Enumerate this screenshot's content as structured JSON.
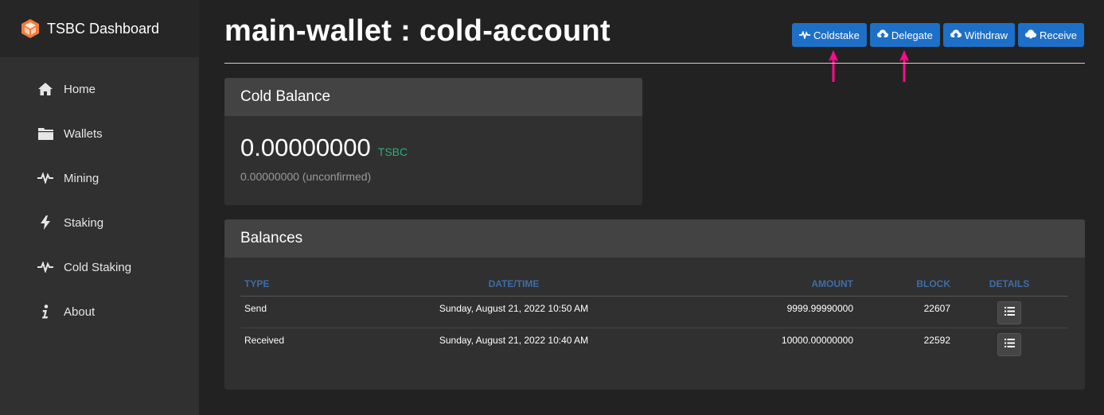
{
  "brand": {
    "name": "TSBC Dashboard",
    "logo_color": "#ef7d3a"
  },
  "sidebar": {
    "items": [
      {
        "label": "Home",
        "icon": "home-icon"
      },
      {
        "label": "Wallets",
        "icon": "folder-icon"
      },
      {
        "label": "Mining",
        "icon": "pulse-icon"
      },
      {
        "label": "Staking",
        "icon": "bolt-icon"
      },
      {
        "label": "Cold Staking",
        "icon": "pulse-icon"
      },
      {
        "label": "About",
        "icon": "info-icon"
      }
    ]
  },
  "header": {
    "title": "main-wallet : cold-account",
    "actions": [
      {
        "label": "Coldstake",
        "icon": "pulse-icon"
      },
      {
        "label": "Delegate",
        "icon": "cloud-upload-icon"
      },
      {
        "label": "Withdraw",
        "icon": "cloud-upload-icon"
      },
      {
        "label": "Receive",
        "icon": "cloud-download-icon"
      }
    ],
    "accent_color": "#1e6fc7",
    "annotation_arrow_color": "#ff0a8a"
  },
  "cold_balance": {
    "title": "Cold Balance",
    "value": "0.00000000",
    "unit": "TSBC",
    "unconfirmed": "0.00000000 (unconfirmed)"
  },
  "balances": {
    "title": "Balances",
    "columns": [
      "TYPE",
      "DATE/TIME",
      "AMOUNT",
      "BLOCK",
      "DETAILS"
    ],
    "rows": [
      {
        "type": "Send",
        "datetime": "Sunday, August 21, 2022 10:50 AM",
        "amount": "9999.99990000",
        "block": "22607"
      },
      {
        "type": "Received",
        "datetime": "Sunday, August 21, 2022 10:40 AM",
        "amount": "10000.00000000",
        "block": "22592"
      }
    ]
  }
}
